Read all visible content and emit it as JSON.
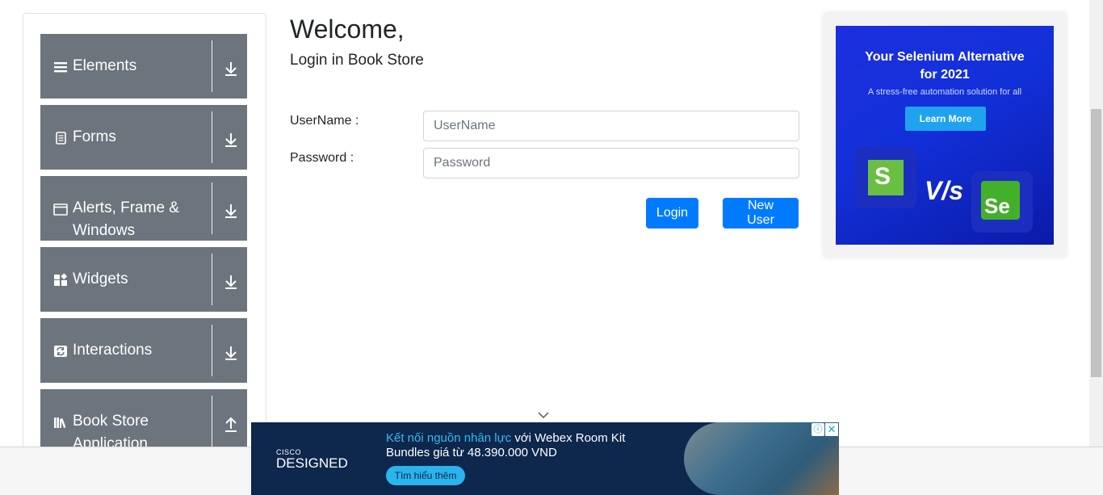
{
  "sidebar": {
    "groups": [
      {
        "label": "Elements",
        "icon": "hamburger-icon",
        "arrow": "download-arrow-icon"
      },
      {
        "label": "Forms",
        "icon": "document-icon",
        "arrow": "download-arrow-icon"
      },
      {
        "label": "Alerts, Frame & Windows",
        "icon": "window-icon",
        "arrow": "download-arrow-icon"
      },
      {
        "label": "Widgets",
        "icon": "widgets-icon",
        "arrow": "download-arrow-icon"
      },
      {
        "label": "Interactions",
        "icon": "refresh-icon",
        "arrow": "download-arrow-icon"
      },
      {
        "label": "Book Store Application",
        "icon": "books-icon",
        "arrow": "upload-arrow-icon"
      }
    ]
  },
  "main": {
    "heading": "Welcome,",
    "subheading": "Login in Book Store",
    "username_label": "UserName :",
    "username_placeholder": "UserName",
    "username_value": "",
    "password_label": "Password :",
    "password_placeholder": "Password",
    "password_value": "",
    "login_button": "Login",
    "new_user_button": "New User"
  },
  "ad_right": {
    "title_line1": "Your Selenium Alternative",
    "title_line2": "for 2021",
    "subtitle": "A stress-free automation solution for all",
    "cta": "Learn More",
    "vs_text": "V/s",
    "logo_left_letter": "S",
    "logo_right_letter": "Se"
  },
  "ad_bottom": {
    "brand_small": "CISCO",
    "brand_large": "DESIGNED",
    "line1_highlight": "Kết nối nguồn nhân lực",
    "line1_rest": " với Webex Room Kit",
    "line2": "Bundles giá từ 48.390.000 VND",
    "cta": "Tìm hiểu thêm",
    "info_symbol": "ⓘ",
    "close_symbol": "✕"
  },
  "colors": {
    "menu_bg": "#6c757d",
    "primary": "#007bff",
    "ad_blue": "#1d2fe0",
    "ad_navy": "#0d274d"
  }
}
